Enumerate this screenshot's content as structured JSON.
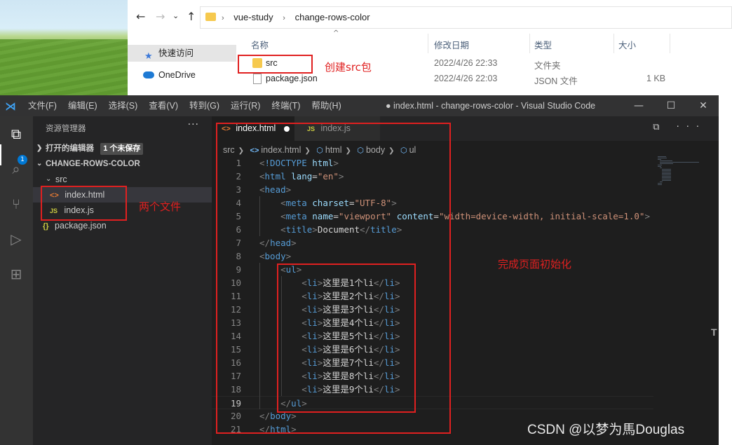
{
  "explorer": {
    "nav": {
      "back": "←",
      "forward": "→",
      "dropdown": "⌄",
      "up": "↑"
    },
    "address": [
      "vue-study",
      "change-rows-color"
    ],
    "address_sep": "›",
    "sidebar": [
      {
        "label": "快速访问"
      },
      {
        "label": "OneDrive"
      }
    ],
    "columns": {
      "name": "名称",
      "date": "修改日期",
      "type": "类型",
      "size": "大小"
    },
    "files": [
      {
        "name": "src",
        "date": "2022/4/26 22:33",
        "type": "文件夹",
        "size": ""
      },
      {
        "name": "package.json",
        "date": "2022/4/26 22:03",
        "type": "JSON 文件",
        "size": "1 KB"
      }
    ]
  },
  "vscode": {
    "menu": [
      "文件(F)",
      "编辑(E)",
      "选择(S)",
      "查看(V)",
      "转到(G)",
      "运行(R)",
      "终端(T)",
      "帮助(H)"
    ],
    "window_title": "● index.html - change-rows-color - Visual Studio Code",
    "winbtns": {
      "min": "—",
      "max": "☐",
      "close": "✕"
    },
    "activity_badge": "1",
    "sidebar": {
      "header": "资源管理器",
      "more": "···",
      "open_editors": "打开的编辑器",
      "unsaved_badge": "1 个未保存",
      "project": "CHANGE-ROWS-COLOR",
      "folder": "src",
      "files": [
        "index.html",
        "index.js"
      ],
      "root_file": "package.json",
      "icons": {
        "html": "<>",
        "js": "JS",
        "json": "{}"
      }
    },
    "tabs": [
      {
        "label": "index.html",
        "icon": "<>"
      },
      {
        "label": "index.js",
        "icon": "JS"
      }
    ],
    "tab_actions": "⧉ ···",
    "breadcrumbs": [
      "src",
      "index.html",
      "html",
      "body",
      "ul"
    ],
    "code_lines": [
      [
        [
          "t-br",
          "<"
        ],
        [
          "t-tag",
          "!DOCTYPE"
        ],
        [
          "t-txt",
          " "
        ],
        [
          "t-attr",
          "html"
        ],
        [
          "t-br",
          ">"
        ]
      ],
      [
        [
          "t-br",
          "<"
        ],
        [
          "t-tag",
          "html"
        ],
        [
          "t-txt",
          " "
        ],
        [
          "t-attr",
          "lang"
        ],
        [
          "t-txt",
          "="
        ],
        [
          "t-str",
          "\"en\""
        ],
        [
          "t-br",
          ">"
        ]
      ],
      [
        [
          "t-br",
          "<"
        ],
        [
          "t-tag",
          "head"
        ],
        [
          "t-br",
          ">"
        ]
      ],
      [
        [
          "t-txt",
          "    "
        ],
        [
          "t-br",
          "<"
        ],
        [
          "t-tag",
          "meta"
        ],
        [
          "t-txt",
          " "
        ],
        [
          "t-attr",
          "charset"
        ],
        [
          "t-txt",
          "="
        ],
        [
          "t-str",
          "\"UTF-8\""
        ],
        [
          "t-br",
          ">"
        ]
      ],
      [
        [
          "t-txt",
          "    "
        ],
        [
          "t-br",
          "<"
        ],
        [
          "t-tag",
          "meta"
        ],
        [
          "t-txt",
          " "
        ],
        [
          "t-attr",
          "name"
        ],
        [
          "t-txt",
          "="
        ],
        [
          "t-str",
          "\"viewport\""
        ],
        [
          "t-txt",
          " "
        ],
        [
          "t-attr",
          "content"
        ],
        [
          "t-txt",
          "="
        ],
        [
          "t-str",
          "\"width=device-width, initial-scale=1.0\""
        ],
        [
          "t-br",
          ">"
        ]
      ],
      [
        [
          "t-txt",
          "    "
        ],
        [
          "t-br",
          "<"
        ],
        [
          "t-tag",
          "title"
        ],
        [
          "t-br",
          ">"
        ],
        [
          "t-txt",
          "Document"
        ],
        [
          "t-br",
          "</"
        ],
        [
          "t-tag",
          "title"
        ],
        [
          "t-br",
          ">"
        ]
      ],
      [
        [
          "t-br",
          "</"
        ],
        [
          "t-tag",
          "head"
        ],
        [
          "t-br",
          ">"
        ]
      ],
      [
        [
          "t-br",
          "<"
        ],
        [
          "t-tag",
          "body"
        ],
        [
          "t-br",
          ">"
        ]
      ],
      [
        [
          "t-txt",
          "    "
        ],
        [
          "t-br",
          "<"
        ],
        [
          "t-tag",
          "ul"
        ],
        [
          "t-br",
          ">"
        ]
      ],
      [
        [
          "t-txt",
          "        "
        ],
        [
          "t-br",
          "<"
        ],
        [
          "t-tag",
          "li"
        ],
        [
          "t-br",
          ">"
        ],
        [
          "t-txt",
          "这里是1个li"
        ],
        [
          "t-br",
          "</"
        ],
        [
          "t-tag",
          "li"
        ],
        [
          "t-br",
          ">"
        ]
      ],
      [
        [
          "t-txt",
          "        "
        ],
        [
          "t-br",
          "<"
        ],
        [
          "t-tag",
          "li"
        ],
        [
          "t-br",
          ">"
        ],
        [
          "t-txt",
          "这里是2个li"
        ],
        [
          "t-br",
          "</"
        ],
        [
          "t-tag",
          "li"
        ],
        [
          "t-br",
          ">"
        ]
      ],
      [
        [
          "t-txt",
          "        "
        ],
        [
          "t-br",
          "<"
        ],
        [
          "t-tag",
          "li"
        ],
        [
          "t-br",
          ">"
        ],
        [
          "t-txt",
          "这里是3个li"
        ],
        [
          "t-br",
          "</"
        ],
        [
          "t-tag",
          "li"
        ],
        [
          "t-br",
          ">"
        ]
      ],
      [
        [
          "t-txt",
          "        "
        ],
        [
          "t-br",
          "<"
        ],
        [
          "t-tag",
          "li"
        ],
        [
          "t-br",
          ">"
        ],
        [
          "t-txt",
          "这里是4个li"
        ],
        [
          "t-br",
          "</"
        ],
        [
          "t-tag",
          "li"
        ],
        [
          "t-br",
          ">"
        ]
      ],
      [
        [
          "t-txt",
          "        "
        ],
        [
          "t-br",
          "<"
        ],
        [
          "t-tag",
          "li"
        ],
        [
          "t-br",
          ">"
        ],
        [
          "t-txt",
          "这里是5个li"
        ],
        [
          "t-br",
          "</"
        ],
        [
          "t-tag",
          "li"
        ],
        [
          "t-br",
          ">"
        ]
      ],
      [
        [
          "t-txt",
          "        "
        ],
        [
          "t-br",
          "<"
        ],
        [
          "t-tag",
          "li"
        ],
        [
          "t-br",
          ">"
        ],
        [
          "t-txt",
          "这里是6个li"
        ],
        [
          "t-br",
          "</"
        ],
        [
          "t-tag",
          "li"
        ],
        [
          "t-br",
          ">"
        ]
      ],
      [
        [
          "t-txt",
          "        "
        ],
        [
          "t-br",
          "<"
        ],
        [
          "t-tag",
          "li"
        ],
        [
          "t-br",
          ">"
        ],
        [
          "t-txt",
          "这里是7个li"
        ],
        [
          "t-br",
          "</"
        ],
        [
          "t-tag",
          "li"
        ],
        [
          "t-br",
          ">"
        ]
      ],
      [
        [
          "t-txt",
          "        "
        ],
        [
          "t-br",
          "<"
        ],
        [
          "t-tag",
          "li"
        ],
        [
          "t-br",
          ">"
        ],
        [
          "t-txt",
          "这里是8个li"
        ],
        [
          "t-br",
          "</"
        ],
        [
          "t-tag",
          "li"
        ],
        [
          "t-br",
          ">"
        ]
      ],
      [
        [
          "t-txt",
          "        "
        ],
        [
          "t-br",
          "<"
        ],
        [
          "t-tag",
          "li"
        ],
        [
          "t-br",
          ">"
        ],
        [
          "t-txt",
          "这里是9个li"
        ],
        [
          "t-br",
          "</"
        ],
        [
          "t-tag",
          "li"
        ],
        [
          "t-br",
          ">"
        ]
      ],
      [
        [
          "t-txt",
          "    "
        ],
        [
          "t-br",
          "</"
        ],
        [
          "t-tag",
          "ul"
        ],
        [
          "t-br",
          ">"
        ]
      ],
      [
        [
          "t-br",
          "</"
        ],
        [
          "t-tag",
          "body"
        ],
        [
          "t-br",
          ">"
        ]
      ],
      [
        [
          "t-br",
          "</"
        ],
        [
          "t-tag",
          "html"
        ],
        [
          "t-br",
          ">"
        ]
      ]
    ],
    "cursor_line": 19,
    "scroll_marker": "T"
  },
  "annotations": {
    "create_src": "创建src包",
    "two_files": "两个文件",
    "page_init": "完成页面初始化"
  },
  "watermark": "CSDN @以梦为馬Douglas",
  "colors": {
    "annotation_red": "#e02020",
    "vscode_bg": "#1e1e1e",
    "tag_blue": "#569cd6",
    "string_orange": "#ce9178",
    "attr_lightblue": "#9cdcfe"
  }
}
